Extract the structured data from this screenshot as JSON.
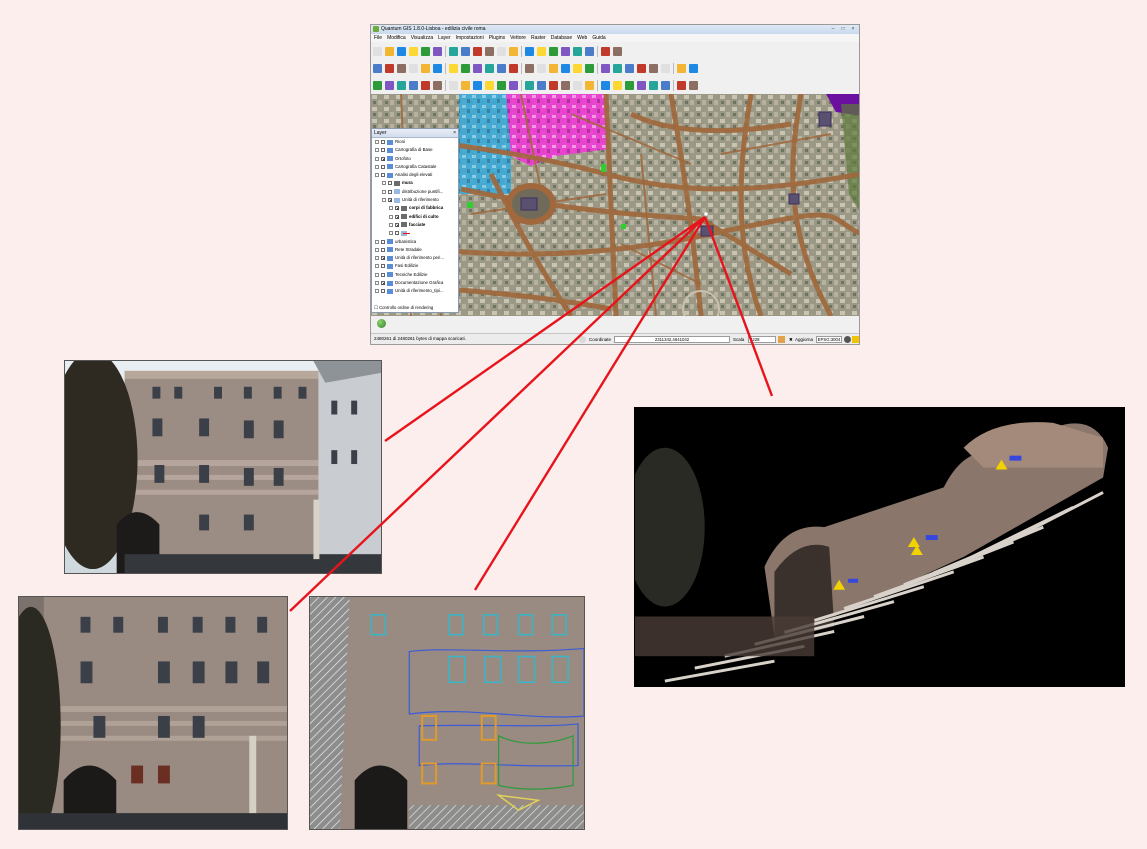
{
  "window": {
    "title": "Quantum GIS 1.8.0-Lisboa - edilizia civile roma",
    "controls": [
      "minimize-icon",
      "maximize-icon",
      "close-icon"
    ]
  },
  "menu": [
    "File",
    "Modifica",
    "Visualizza",
    "Layer",
    "Impostazioni",
    "Plugins",
    "Vettore",
    "Raster",
    "Database",
    "Web",
    "Guida"
  ],
  "layers_panel": {
    "title": "Layer",
    "items": [
      {
        "label": "Rioni",
        "level": 0,
        "checked": false
      },
      {
        "label": "Cartografia di Base",
        "level": 0,
        "checked": false
      },
      {
        "label": "Ortofoto",
        "level": 0,
        "checked": true
      },
      {
        "label": "Cartografia Catastale",
        "level": 0,
        "checked": false
      },
      {
        "label": "Analisi degli elevati",
        "level": 0,
        "checked": false
      },
      {
        "label": "mura",
        "level": 1,
        "checked": false,
        "bold": true
      },
      {
        "label": "distribuzione puntifi...",
        "level": 1,
        "checked": false
      },
      {
        "label": "Unità di riferimento",
        "level": 1,
        "checked": true
      },
      {
        "label": "corpi di fabbrica",
        "level": 2,
        "checked": true,
        "bold": true
      },
      {
        "label": "edifici di culto",
        "level": 2,
        "checked": true,
        "bold": true
      },
      {
        "label": "facciate",
        "level": 2,
        "checked": true,
        "bold": true
      },
      {
        "label": "",
        "level": 2,
        "checked": false
      },
      {
        "label": "urbanistica",
        "level": 0,
        "checked": false
      },
      {
        "label": "Rete Stradale",
        "level": 0,
        "checked": false
      },
      {
        "label": "Unità di riferimento peri...",
        "level": 0,
        "checked": true
      },
      {
        "label": "Fasi Edilizie",
        "level": 0,
        "checked": false
      },
      {
        "label": "Tecniche Edilizie",
        "level": 0,
        "checked": false
      },
      {
        "label": "Documentazione Grafica",
        "level": 0,
        "checked": true
      },
      {
        "label": "Unità di riferimento_tipi...",
        "level": 0,
        "checked": false
      }
    ],
    "render_control": "Controllo ordine di rendering"
  },
  "status": {
    "message": "2480261 di 2480261 bytes di mappa scaricati.",
    "coord_label": "Coordinate",
    "coord_value": "2311342,4641042",
    "scale_label": "Scala",
    "scale_value": "4228",
    "render_label": "Aggiorna",
    "crs": "EPSG:3004"
  },
  "colors": {
    "bg": "#fdeeee",
    "leader_lines": "#e8141b",
    "roads": "#a0683c",
    "rione_cyan": "#35b6e8",
    "rione_magenta": "#ef3ad6",
    "rione_purple": "#6a0fa0"
  },
  "photos": [
    {
      "name": "building-facade-photo"
    },
    {
      "name": "facade-orthophoto"
    },
    {
      "name": "facade-orthophoto-mapped"
    },
    {
      "name": "stairway-point-cloud"
    }
  ]
}
